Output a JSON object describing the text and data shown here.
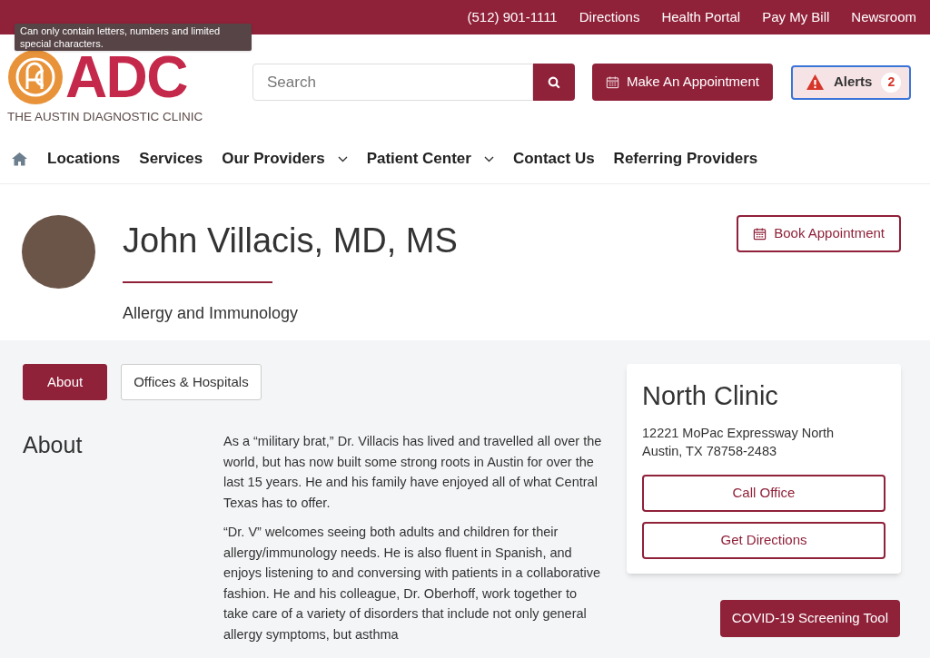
{
  "top_bar": {
    "links": [
      "(512) 901-1111",
      "Directions",
      "Health Portal",
      "Pay My Bill",
      "Newsroom"
    ]
  },
  "tooltip": {
    "text": "Can only contain letters, numbers and limited special characters."
  },
  "logo": {
    "wordmark": "ADC",
    "tagline": "THE AUSTIN DIAGNOSTIC CLINIC"
  },
  "search": {
    "placeholder": "Search"
  },
  "appointment_button": "Make An Appointment",
  "alerts": {
    "label": "Alerts",
    "count": "2"
  },
  "nav": [
    {
      "label": "Locations",
      "kind": "link"
    },
    {
      "label": "Services",
      "kind": "link"
    },
    {
      "label": "Our Providers",
      "kind": "dropdown"
    },
    {
      "label": "Patient Center",
      "kind": "dropdown"
    },
    {
      "label": "Contact Us",
      "kind": "link"
    },
    {
      "label": "Referring Providers",
      "kind": "link"
    }
  ],
  "profile": {
    "name": "John Villacis, MD, MS",
    "specialty": "Allergy and Immunology",
    "book_button": "Book Appointment"
  },
  "tabs": [
    {
      "label": "About",
      "selected": true
    },
    {
      "label": "Offices & Hospitals",
      "selected": false
    }
  ],
  "about": {
    "heading": "About",
    "paragraphs": [
      "As a “military brat,” Dr. Villacis has lived and travelled all over the world, but has now built some strong roots in Austin for over the last 15 years. He and his family have enjoyed all of what Central Texas has to offer.",
      "“Dr. V” welcomes seeing both adults and children for their allergy/immunology needs. He is also fluent in Spanish, and enjoys listening to and conversing with patients in a collaborative fashion. He and his colleague, Dr. Oberhoff, work together to take care of a variety of disorders that include not only general allergy symptoms, but asthma"
    ]
  },
  "clinic": {
    "name": "North Clinic",
    "address": [
      "12221 MoPac Expressway North",
      "Austin, TX 78758-2483"
    ],
    "buttons": [
      "Call Office",
      "Get Directions"
    ]
  },
  "covid_button": "COVID-19 Screening Tool"
}
